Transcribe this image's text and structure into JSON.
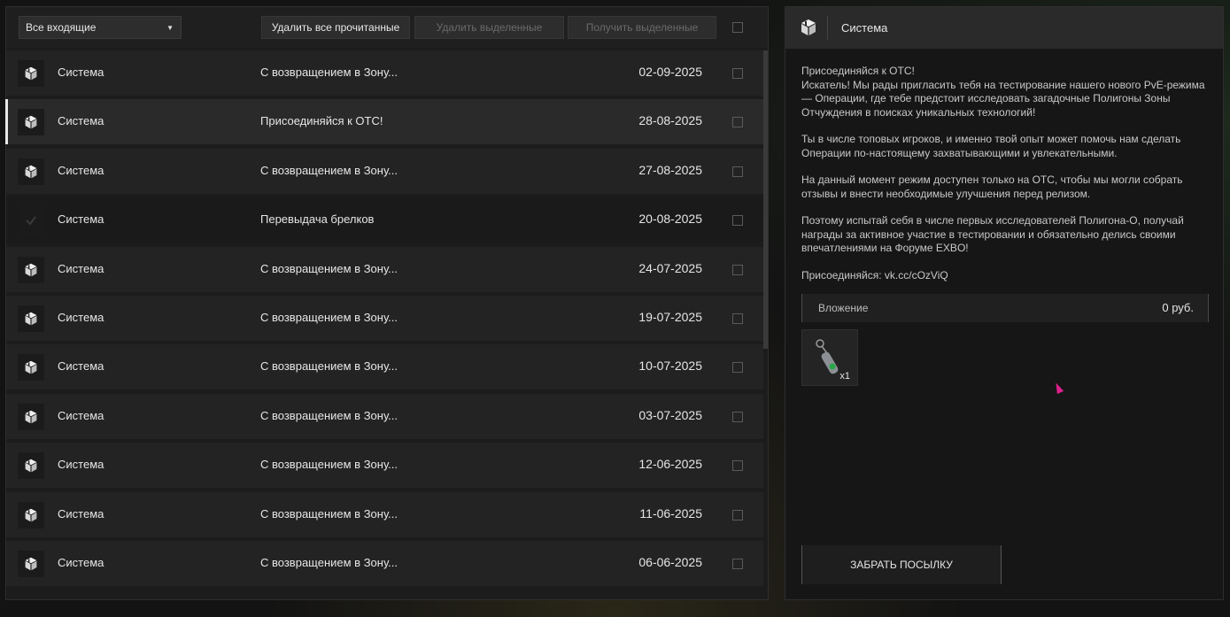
{
  "toolbar": {
    "filter_value": "Все входящие",
    "delete_read_label": "Удалить все прочитанные",
    "delete_selected_label": "Удалить выделенные",
    "receive_selected_label": "Получить выделенные"
  },
  "messages": [
    {
      "sender": "Система",
      "subject": "С возвращением в Зону...",
      "date": "02-09-2025",
      "icon": "package-icon"
    },
    {
      "sender": "Система",
      "subject": "Присоединяйся к ОТС!",
      "date": "28-08-2025",
      "icon": "package-icon"
    },
    {
      "sender": "Система",
      "subject": "С возвращением в Зону...",
      "date": "27-08-2025",
      "icon": "package-icon"
    },
    {
      "sender": "Система",
      "subject": "Перевыдача брелков",
      "date": "20-08-2025",
      "icon": "check-icon"
    },
    {
      "sender": "Система",
      "subject": "С возвращением в Зону...",
      "date": "24-07-2025",
      "icon": "package-icon"
    },
    {
      "sender": "Система",
      "subject": "С возвращением в Зону...",
      "date": "19-07-2025",
      "icon": "package-icon"
    },
    {
      "sender": "Система",
      "subject": "С возвращением в Зону...",
      "date": "10-07-2025",
      "icon": "package-icon"
    },
    {
      "sender": "Система",
      "subject": "С возвращением в Зону...",
      "date": "03-07-2025",
      "icon": "package-icon"
    },
    {
      "sender": "Система",
      "subject": "С возвращением в Зону...",
      "date": "12-06-2025",
      "icon": "package-icon"
    },
    {
      "sender": "Система",
      "subject": "С возвращением в Зону...",
      "date": "11-06-2025",
      "icon": "package-icon"
    },
    {
      "sender": "Система",
      "subject": "С возвращением в Зону...",
      "date": "06-06-2025",
      "icon": "package-icon"
    }
  ],
  "detail": {
    "sender": "Система",
    "paragraphs": [
      "Присоединяйся к ОТС!\nИскатель! Мы рады пригласить тебя на тестирование нашего нового PvE-режима — Операции, где тебе предстоит исследовать загадочные Полигоны Зоны Отчуждения в поисках уникальных технологий!",
      "Ты в числе топовых игроков, и именно твой опыт может помочь нам сделать Операции по-настоящему захватывающими и увлекательными.",
      "На данный момент режим доступен только на ОТС, чтобы мы могли собрать отзывы и внести необходимые улучшения перед релизом.",
      "Поэтому испытай себя в числе первых исследователей Полигона-О, получай награды за активное участие в тестировании и обязательно делись своими впечатлениями на Форуме EXBO!",
      "Присоединяйся: vk.cc/cOzViQ"
    ],
    "attachment_label": "Вложение",
    "attachment_value": "0 руб.",
    "attachment_item_qty": "x1",
    "attachment_item_icon": "keychain-icon",
    "claim_label": "ЗАБРАТЬ ПОСЫЛКУ"
  },
  "colors": {
    "selected_indicator": "#e8e8e8",
    "cursor": "#e0208e"
  }
}
